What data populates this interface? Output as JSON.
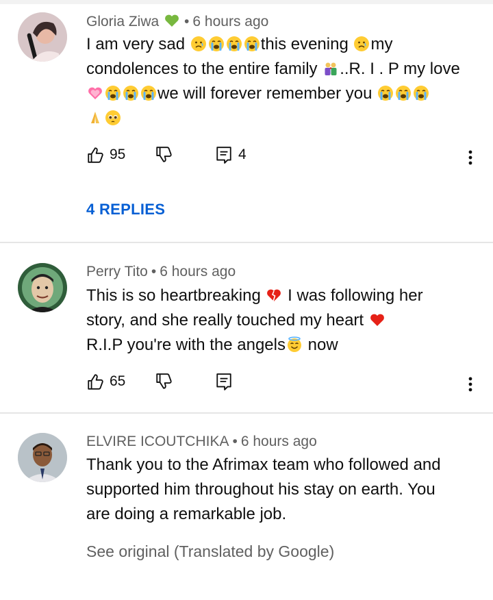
{
  "comments": [
    {
      "author": "Gloria Ziwa",
      "timestamp": "6 hours ago",
      "lines": [
        {
          "parts": [
            "I am very sad ",
            "",
            "this evening ",
            "my"
          ]
        },
        {
          "parts": [
            "condolences to the entire family ",
            "..R. I . P my love"
          ]
        },
        {
          "parts": [
            "",
            "we will forever remember you ",
            ""
          ]
        },
        {
          "parts": [
            ""
          ]
        }
      ],
      "likes": "95",
      "reply_count": "4",
      "replies_label": "4 REPLIES",
      "icons": [
        "green-heart-icon",
        "crying-face-icon",
        "couple-icon",
        "pink-heart-icon",
        "praying-hands-icon",
        "pleading-face-icon"
      ]
    },
    {
      "author": "Perry Tito",
      "timestamp": "6 hours ago",
      "lines": [
        {
          "parts": [
            "This is so heartbreaking ",
            " I was following her"
          ]
        },
        {
          "parts": [
            "story, and she really touched my  heart "
          ]
        },
        {
          "parts": [
            "R.I.P you're with the angels",
            " now"
          ]
        }
      ],
      "likes": "65",
      "icons": [
        "broken-heart-icon",
        "red-heart-icon",
        "halo-face-icon"
      ]
    },
    {
      "author": "ELVIRE ICOUTCHIKA",
      "timestamp": "6 hours ago",
      "lines": [
        {
          "parts": [
            "Thank you to the Afrimax team who followed and"
          ]
        },
        {
          "parts": [
            "supported him throughout his stay on earth. You"
          ]
        },
        {
          "parts": [
            "are doing a remarkable job."
          ]
        }
      ],
      "see_original": "See original (Translated by Google)"
    }
  ],
  "colors": {
    "accent": "#065fd4",
    "meta_text": "#606060",
    "divider": "#e5e5e5"
  }
}
